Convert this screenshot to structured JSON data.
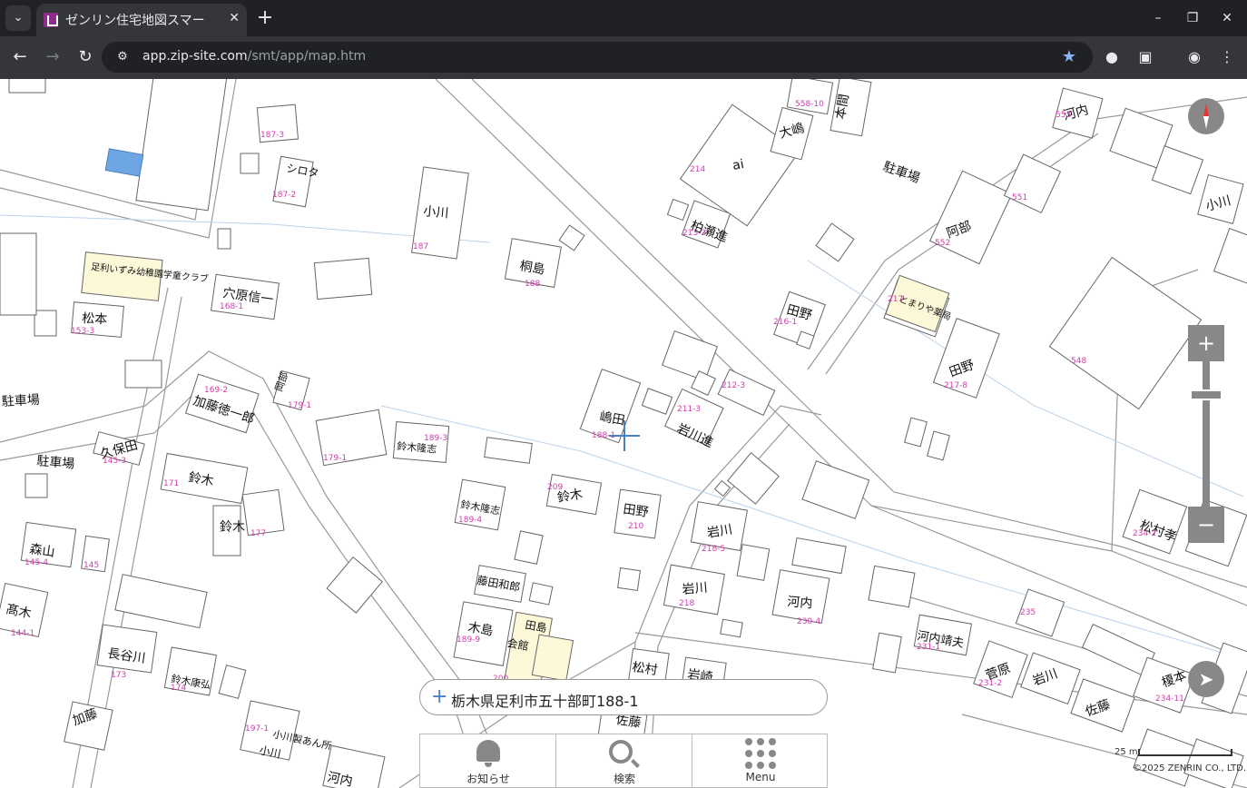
{
  "browser": {
    "tab_title": "ゼンリン住宅地図スマー",
    "tab_close": "✕",
    "new_tab": "+",
    "tab_menu": "⌄",
    "url_host": "app.zip-site.com",
    "url_path": "/smt/app/map.htm",
    "window_minimize": "–",
    "window_restore": "❐",
    "window_close": "✕",
    "back": "←",
    "forward": "→",
    "reload": "↻",
    "star": "★",
    "menu": "⋮"
  },
  "map": {
    "address": "栃木県足利市五十部町188-1",
    "zoom_in": "+",
    "zoom_out": "−",
    "locate": "➤",
    "scale_label": "25 m",
    "copyright": "©2025 ZENRIN CO., LTD.",
    "labels": [
      {
        "text": "駐車場"
      },
      {
        "text": "阿部"
      },
      {
        "text": "河内"
      },
      {
        "text": "小川"
      },
      {
        "text": "大嶋"
      },
      {
        "text": "本間"
      },
      {
        "text": "ai"
      },
      {
        "text": "柏瀬進"
      },
      {
        "text": "桐島"
      },
      {
        "text": "小川"
      },
      {
        "text": "穴原信一"
      },
      {
        "text": "松本"
      },
      {
        "text": "駐車場"
      },
      {
        "text": "加藤徳一郎"
      },
      {
        "text": "久保田"
      },
      {
        "text": "駐車場"
      },
      {
        "text": "鈴木"
      },
      {
        "text": "鈴木"
      },
      {
        "text": "森山"
      },
      {
        "text": "髙木"
      },
      {
        "text": "長谷川"
      },
      {
        "text": "加藤"
      },
      {
        "text": "鈴木康弘"
      },
      {
        "text": "鈴木隆志"
      },
      {
        "text": "鈴木隆志"
      },
      {
        "text": "嶋田"
      },
      {
        "text": "岩川進"
      },
      {
        "text": "田野"
      },
      {
        "text": "田野"
      },
      {
        "text": "田野"
      },
      {
        "text": "鈴木"
      },
      {
        "text": "岩川"
      },
      {
        "text": "岩川"
      },
      {
        "text": "河内"
      },
      {
        "text": "木島"
      },
      {
        "text": "藤田和郎"
      },
      {
        "text": "河内靖夫"
      },
      {
        "text": "菅原"
      },
      {
        "text": "岩川"
      },
      {
        "text": "佐藤"
      },
      {
        "text": "榎本"
      },
      {
        "text": "松村孝"
      },
      {
        "text": "松村"
      },
      {
        "text": "岩崎"
      },
      {
        "text": "佐藤"
      },
      {
        "text": "小川"
      },
      {
        "text": "河内"
      },
      {
        "text": "シロタ"
      },
      {
        "text": "岡部"
      },
      {
        "text": "足利いずみ幼稚園学童クラブ"
      },
      {
        "text": "とまりや薬局"
      },
      {
        "text": "会館"
      },
      {
        "text": "田島"
      },
      {
        "text": "小川製あん所"
      }
    ],
    "numbers": [
      "187-3",
      "187",
      "187-2",
      "188",
      "168-1",
      "153-3",
      "169-2",
      "179-1",
      "179-1",
      "189-3",
      "145-3",
      "171",
      "177",
      "145-4",
      "145",
      "144-1",
      "173",
      "174",
      "197-1",
      "188-1",
      "211-3",
      "212-3",
      "214",
      "213-2",
      "216-1",
      "217",
      "217-8",
      "548",
      "552",
      "553",
      "210",
      "209",
      "218-5",
      "218",
      "230-4",
      "231-1",
      "231-2",
      "189-9",
      "189-4",
      "200",
      "234-2",
      "234-11",
      "235",
      "551",
      "558-10"
    ]
  },
  "bottom_nav": {
    "news_label": "お知らせ",
    "search_label": "検索",
    "menu_label": "Menu"
  }
}
